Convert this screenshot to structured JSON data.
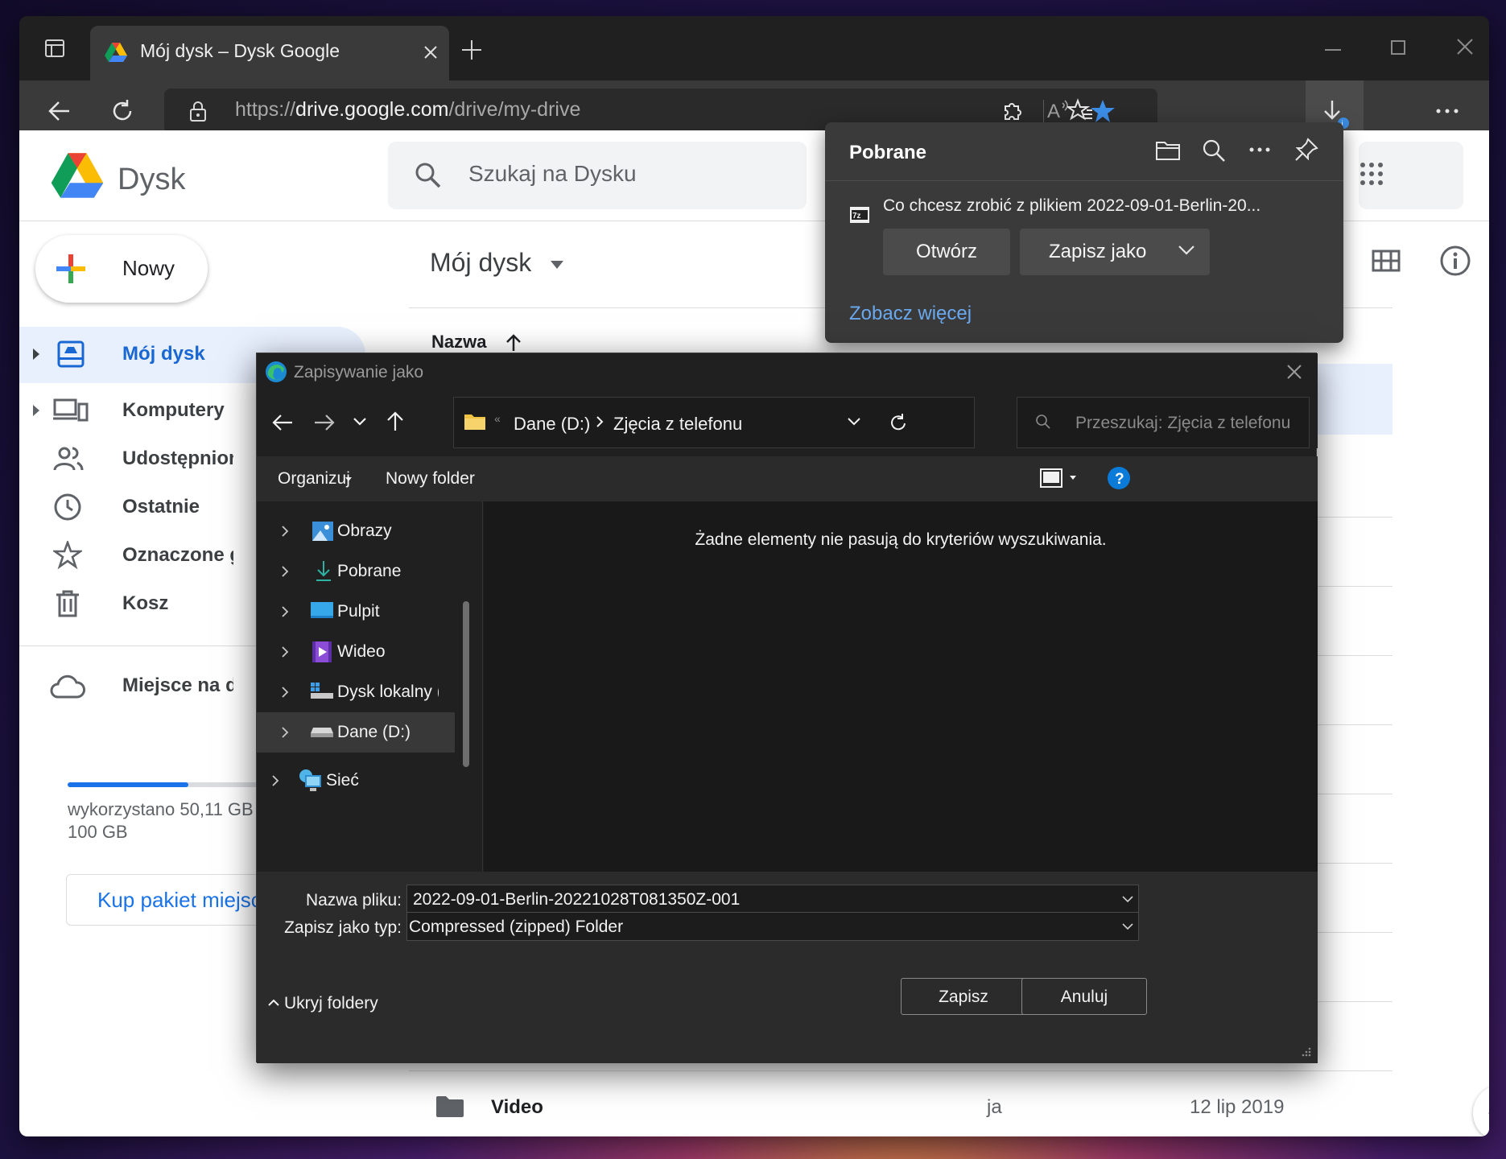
{
  "browser": {
    "tab_title": "Mój dysk – Dysk Google",
    "url_prefix": "https://",
    "url_host": "drive.google.com",
    "url_path": "/drive/my-drive"
  },
  "drive": {
    "app_name": "Dysk",
    "search_placeholder": "Szukaj na Dysku",
    "new_button": "Nowy",
    "nav": [
      {
        "label": "Mój dysk"
      },
      {
        "label": "Komputery"
      },
      {
        "label": "Udostępnione dl"
      },
      {
        "label": "Ostatnie"
      },
      {
        "label": "Oznaczone gwia"
      },
      {
        "label": "Kosz"
      }
    ],
    "storage_label": "Miejsce na dane",
    "storage_used_line1": "wykorzystano 50,11 GB",
    "storage_used_line2": "100 GB",
    "storage_fraction": 0.5011,
    "buy_storage": "Kup pakiet miejsc",
    "breadcrumb": "Mój dysk",
    "column_name": "Nazwa",
    "visible_row": {
      "name": "Video",
      "owner": "ja",
      "modified": "12 lip 2019"
    }
  },
  "downloads": {
    "title": "Pobrane",
    "message": "Co chcesz zrobić z plikiem 2022-09-01-Berlin-20...",
    "open_button": "Otwórz",
    "save_as_button": "Zapisz jako",
    "see_more": "Zobacz więcej"
  },
  "save_dialog": {
    "title": "Zapisywanie jako",
    "path": [
      "Dane (D:)",
      "Zjęcia z telefonu"
    ],
    "search_placeholder": "Przeszukaj: Zjęcia z telefonu",
    "organize": "Organizuj",
    "new_folder": "Nowy folder",
    "tree": [
      {
        "label": "Obrazy",
        "icon": "pictures-icon"
      },
      {
        "label": "Pobrane",
        "icon": "downloads-icon"
      },
      {
        "label": "Pulpit",
        "icon": "desktop-icon"
      },
      {
        "label": "Wideo",
        "icon": "video-icon"
      },
      {
        "label": "Dysk lokalny (C:",
        "icon": "drive-icon"
      },
      {
        "label": "Dane (D:)",
        "icon": "drive-icon",
        "selected": true
      },
      {
        "label": "Sieć",
        "icon": "network-icon"
      }
    ],
    "empty_message": "Żadne elementy nie pasują do kryteriów wyszukiwania.",
    "filename_label": "Nazwa pliku:",
    "filename_value": "2022-09-01-Berlin-20221028T081350Z-001",
    "filetype_label": "Zapisz jako typ:",
    "filetype_value": "Compressed (zipped) Folder",
    "hide_folders": "Ukryj foldery",
    "save_button": "Zapisz",
    "cancel_button": "Anuluj"
  },
  "colors": {
    "accent_blue": "#1a73e8",
    "edge_star": "#3c8ee6",
    "help_blue": "#0a7bd8"
  }
}
